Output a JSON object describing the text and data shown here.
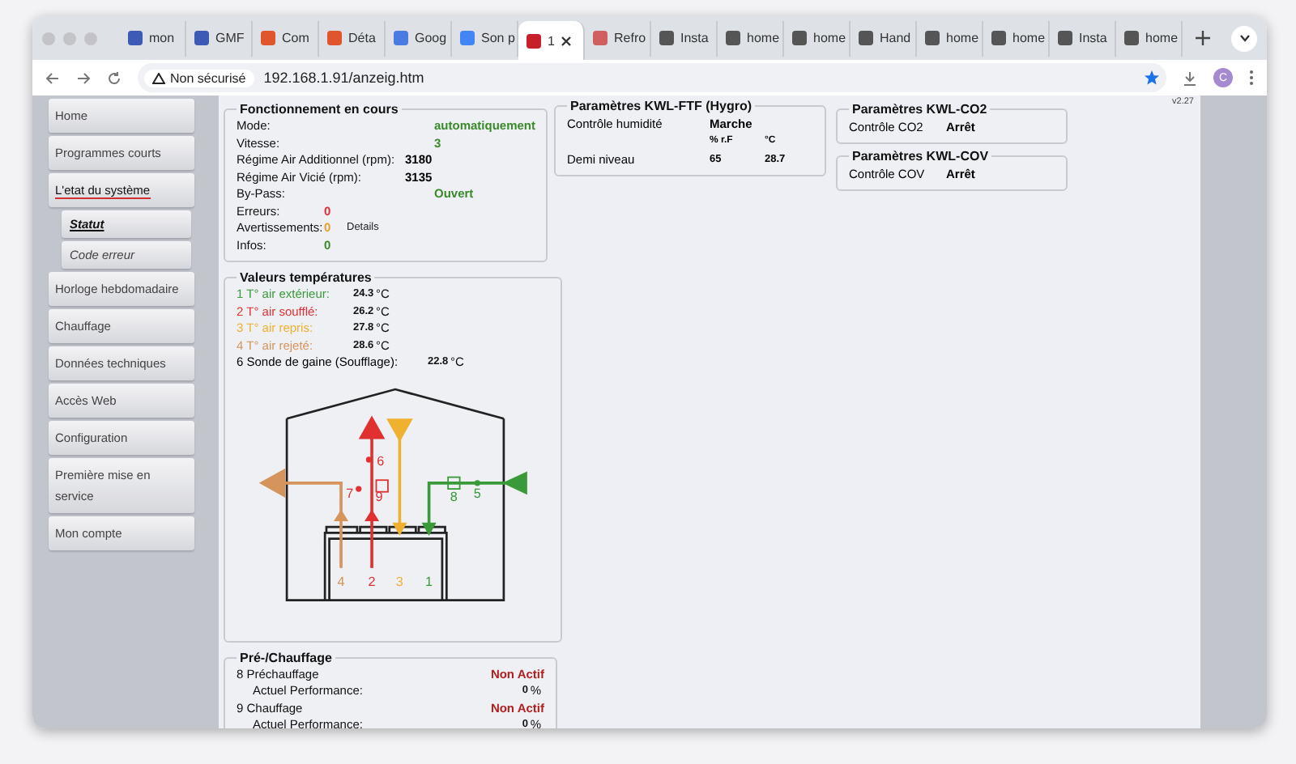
{
  "browser": {
    "tabs": [
      {
        "label": "mon",
        "selected": false,
        "color": "#3b5bb5"
      },
      {
        "label": "GMF",
        "selected": false,
        "color": "#3b5bb5"
      },
      {
        "label": "Com",
        "selected": false,
        "color": "#e0552b"
      },
      {
        "label": "Déta",
        "selected": false,
        "color": "#e0552b"
      },
      {
        "label": "Goog",
        "selected": false,
        "color": "#4a7be0"
      },
      {
        "label": "Son p",
        "selected": false,
        "color": "#4285f4"
      },
      {
        "label": "1",
        "selected": true,
        "color": "#c8202a"
      },
      {
        "label": "Refro",
        "selected": false,
        "color": "#d06060"
      },
      {
        "label": "Insta",
        "selected": false,
        "color": "#555555"
      },
      {
        "label": "home",
        "selected": false,
        "color": "#555555"
      },
      {
        "label": "home",
        "selected": false,
        "color": "#555555"
      },
      {
        "label": "Hand",
        "selected": false,
        "color": "#555555"
      },
      {
        "label": "home",
        "selected": false,
        "color": "#555555"
      },
      {
        "label": "home",
        "selected": false,
        "color": "#555555"
      },
      {
        "label": "Insta",
        "selected": false,
        "color": "#555555"
      },
      {
        "label": "home",
        "selected": false,
        "color": "#555555"
      }
    ],
    "security": "Non sécurisé",
    "url": "192.168.1.91/anzeig.htm",
    "profile": "C"
  },
  "sidebar": {
    "items": [
      {
        "label": "Home",
        "selected": false
      },
      {
        "label": "Programmes courts",
        "selected": false
      },
      {
        "label": "L'etat du système",
        "selected": true,
        "children": [
          {
            "label": "Statut",
            "selected": true
          },
          {
            "label": "Code erreur",
            "selected": false
          }
        ]
      },
      {
        "label": "Horloge hebdomadaire",
        "selected": false
      },
      {
        "label": "Chauffage",
        "selected": false
      },
      {
        "label": "Données techniques",
        "selected": false
      },
      {
        "label": "Accès Web",
        "selected": false
      },
      {
        "label": "Configuration",
        "selected": false
      },
      {
        "label": "Première mise en service",
        "selected": false
      },
      {
        "label": "Mon compte",
        "selected": false
      }
    ]
  },
  "version": "v2.27",
  "operation": {
    "title": "Fonctionnement en cours",
    "rows": [
      {
        "label": "Mode:",
        "value": "automatiquement",
        "color": "#3a8a2a",
        "kind": "wide"
      },
      {
        "label": "Vitesse:",
        "value": "3",
        "color": "#3a8a2a",
        "kind": "wide"
      },
      {
        "label": "Régime Air Additionnel (rpm):",
        "value": "3180",
        "color": "#000000",
        "kind": "wide"
      },
      {
        "label": "Régime Air Vicié (rpm):",
        "value": "3135",
        "color": "#000000",
        "kind": "wide"
      },
      {
        "label": "By-Pass:",
        "value": "Ouvert",
        "color": "#3a8a2a",
        "kind": "wide"
      },
      {
        "label": "Erreurs:",
        "value": "0",
        "color": "#e03030",
        "kind": "narrow"
      },
      {
        "label": "Avertissements:",
        "value": "0",
        "color": "#e8a030",
        "kind": "narrow",
        "link": "Details"
      },
      {
        "label": "Infos:",
        "value": "0",
        "color": "#3a8a2a",
        "kind": "narrow"
      }
    ]
  },
  "temperatures": {
    "title": "Valeurs températures",
    "rows": [
      {
        "label": "1 T° air extérieur:",
        "value": "24.3",
        "unit": "°C",
        "color": "#3a9a3a"
      },
      {
        "label": "2 T° air soufflé:",
        "value": "26.2",
        "unit": "°C",
        "color": "#e03030"
      },
      {
        "label": "3 T° air repris:",
        "value": "27.8",
        "unit": "°C",
        "color": "#f0b030"
      },
      {
        "label": "4 T° air rejeté:",
        "value": "28.6",
        "unit": "°C",
        "color": "#d4945c"
      },
      {
        "label": "6 Sonde de gaine (Soufflage):",
        "value": "22.8",
        "unit": "°C",
        "color": "#000000"
      }
    ],
    "diagram_labels": [
      {
        "text": "4",
        "color": "#d4945c"
      },
      {
        "text": "2",
        "color": "#e03030"
      },
      {
        "text": "3",
        "color": "#f0b030"
      },
      {
        "text": "1",
        "color": "#3a9a3a"
      },
      {
        "text": "6",
        "color": "#e03030"
      },
      {
        "text": "7",
        "color": "#e03030"
      },
      {
        "text": "9",
        "color": "#e03030"
      },
      {
        "text": "8",
        "color": "#3a9a3a"
      },
      {
        "text": "5",
        "color": "#3a9a3a"
      }
    ]
  },
  "heating": {
    "title": "Pré-/Chauffage",
    "rows": [
      {
        "kind": "heater",
        "label": "8 Préchauffage",
        "value": "Non Actif"
      },
      {
        "kind": "performance",
        "label": "Actuel Performance:",
        "value": "0",
        "unit": "%"
      },
      {
        "kind": "heater",
        "label": "9 Chauffage",
        "value": "Non Actif"
      },
      {
        "kind": "performance",
        "label": "Actuel Performance:",
        "value": "0",
        "unit": "%"
      }
    ]
  },
  "hygro": {
    "title": "Paramètres KWL-FTF (Hygro)",
    "control_label": "Contrôle humidité",
    "control_value": "Marche",
    "col_1": "% r.F",
    "col_2": "°C",
    "level_label": "Demi niveau",
    "humidity": "65",
    "temperature": "28.7"
  },
  "co2": {
    "title": "Paramètres KWL-CO2",
    "label": "Contrôle CO2",
    "value": "Arrêt"
  },
  "cov": {
    "title": "Paramètres KWL-COV",
    "label": "Contrôle COV",
    "value": "Arrêt"
  }
}
